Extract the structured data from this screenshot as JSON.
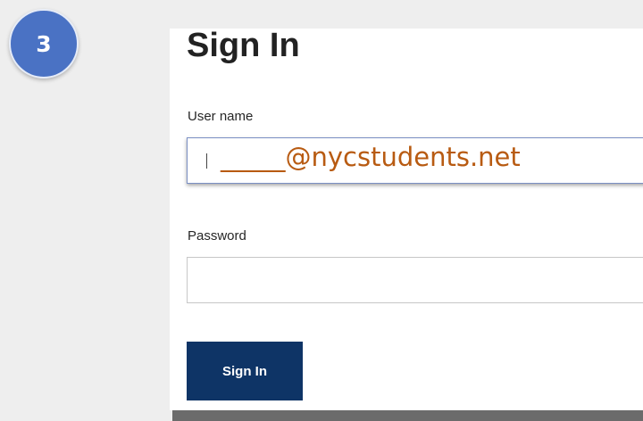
{
  "step_badge": "3",
  "form": {
    "title": "Sign In",
    "username_label": "User name",
    "username_value": "_____@nycstudents.net",
    "password_label": "Password",
    "password_value": "",
    "submit_label": "Sign In"
  },
  "colors": {
    "badge": "#4a72c4",
    "button": "#0e3466",
    "username_text": "#b85b12"
  }
}
